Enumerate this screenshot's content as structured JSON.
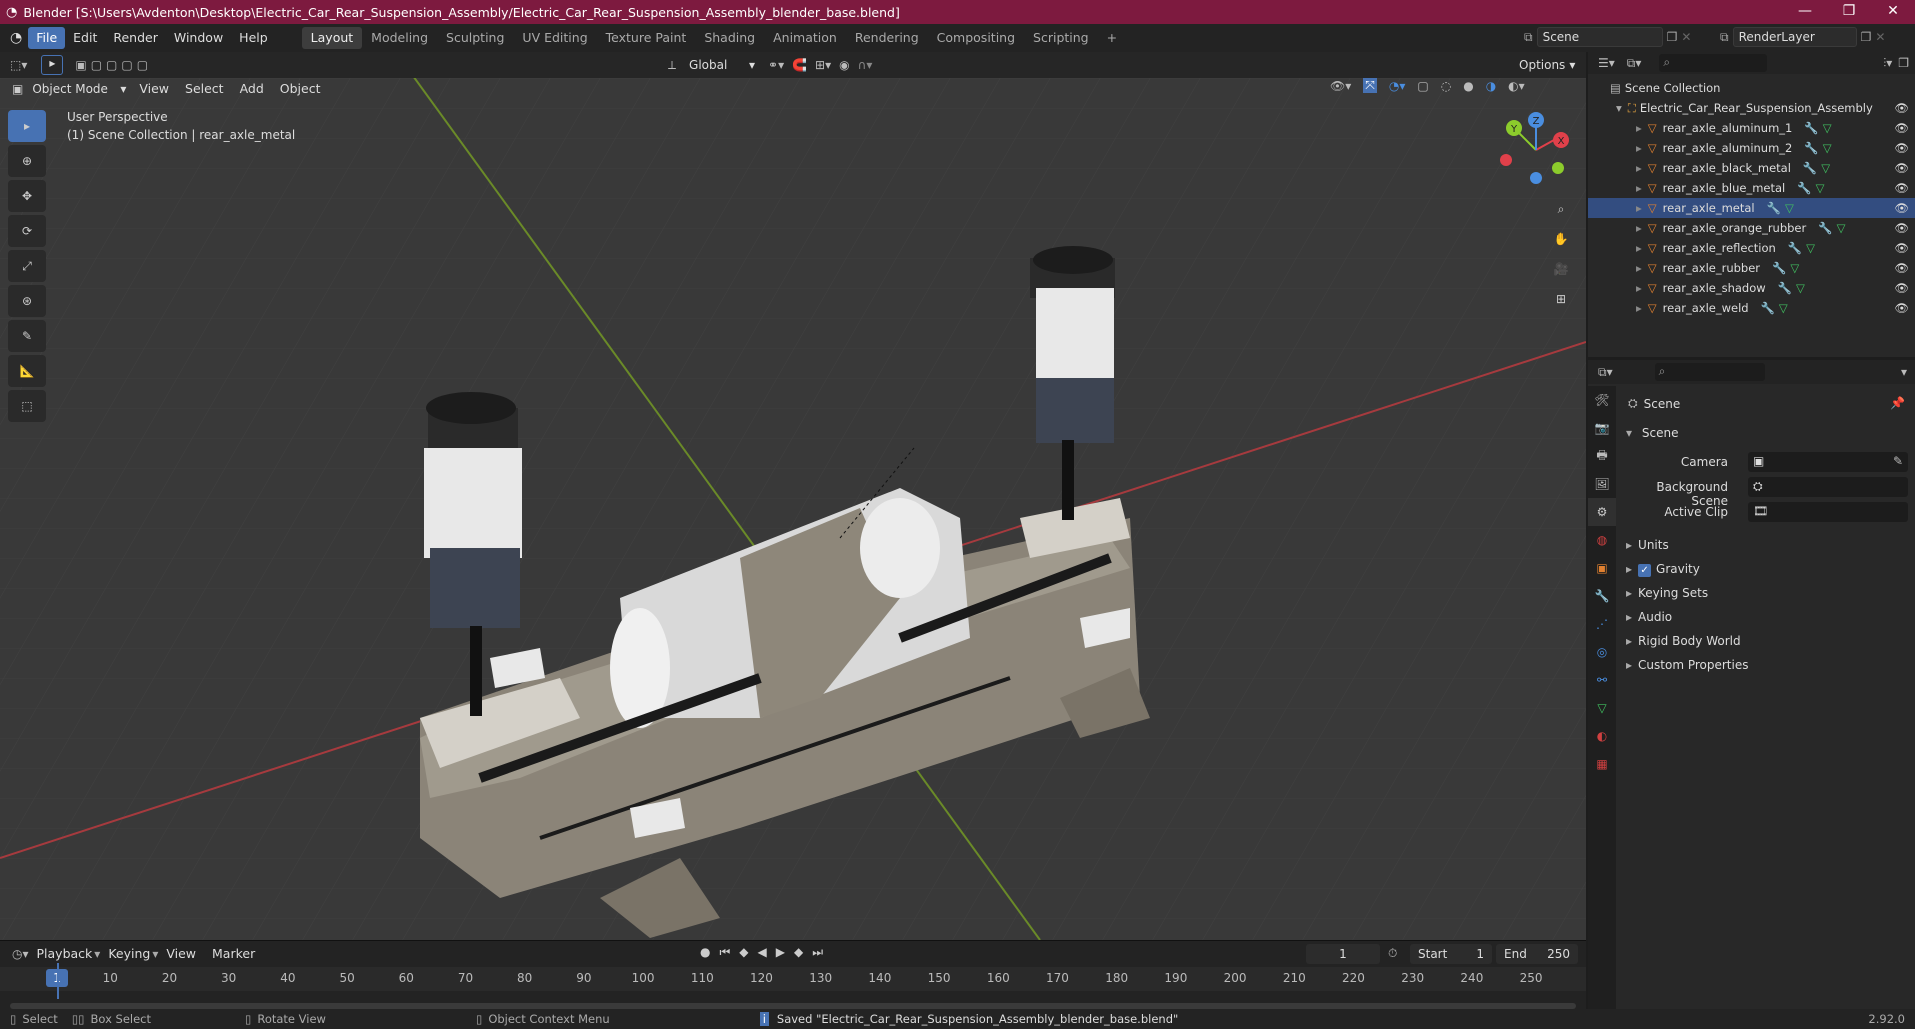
{
  "window": {
    "title": "Blender [S:\\Users\\Avdenton\\Desktop\\Electric_Car_Rear_Suspension_Assembly/Electric_Car_Rear_Suspension_Assembly_blender_base.blend]",
    "minimize": "—",
    "maximize": "❐",
    "close": "✕"
  },
  "menu": {
    "items": [
      "File",
      "Edit",
      "Render",
      "Window",
      "Help"
    ],
    "workspaces": [
      "Layout",
      "Modeling",
      "Sculpting",
      "UV Editing",
      "Texture Paint",
      "Shading",
      "Animation",
      "Rendering",
      "Compositing",
      "Scripting"
    ],
    "add_workspace": "+",
    "scene_name": "Scene",
    "render_layer": "RenderLayer"
  },
  "viewport_header": {
    "transform_orientation": "Global",
    "options_label": "Options",
    "mode": "Object Mode",
    "menus": [
      "View",
      "Select",
      "Add",
      "Object"
    ]
  },
  "viewport": {
    "perspective_label": "User Perspective",
    "collection_label": "(1) Scene Collection | rear_axle_metal",
    "gizmo": {
      "x": "X",
      "y": "Y",
      "z": "Z"
    }
  },
  "outliner": {
    "root": "Scene Collection",
    "collection": "Electric_Car_Rear_Suspension_Assembly",
    "objects": [
      "rear_axle_aluminum_1",
      "rear_axle_aluminum_2",
      "rear_axle_black_metal",
      "rear_axle_blue_metal",
      "rear_axle_metal",
      "rear_axle_orange_rubber",
      "rear_axle_reflection",
      "rear_axle_rubber",
      "rear_axle_shadow",
      "rear_axle_weld"
    ]
  },
  "properties": {
    "context": "Scene",
    "panel": "Scene",
    "fields": {
      "camera": "Camera",
      "background_scene": "Background Scene",
      "active_clip": "Active Clip"
    },
    "sections": [
      "Units",
      "Gravity",
      "Keying Sets",
      "Audio",
      "Rigid Body World",
      "Custom Properties"
    ],
    "gravity_checked": true
  },
  "timeline": {
    "menus": [
      "Playback",
      "Keying",
      "View",
      "Marker"
    ],
    "current_frame": "1",
    "start_label": "Start",
    "start_value": "1",
    "end_label": "End",
    "end_value": "250",
    "ruler": [
      "1",
      "10",
      "20",
      "30",
      "40",
      "50",
      "60",
      "70",
      "80",
      "90",
      "100",
      "110",
      "120",
      "130",
      "140",
      "150",
      "160",
      "170",
      "180",
      "190",
      "200",
      "210",
      "220",
      "230",
      "240",
      "250"
    ]
  },
  "statusbar": {
    "select": "Select",
    "box_select": "Box Select",
    "rotate": "Rotate View",
    "context_menu": "Object Context Menu",
    "message": "Saved \"Electric_Car_Rear_Suspension_Assembly_blender_base.blend\"",
    "version": "2.92.0"
  },
  "colors": {
    "titlebar": "#7d1a3f",
    "accent": "#4772b3",
    "x_axis": "#e0404a",
    "y_axis": "#8ccc2c",
    "z_axis": "#4a8ee0"
  }
}
